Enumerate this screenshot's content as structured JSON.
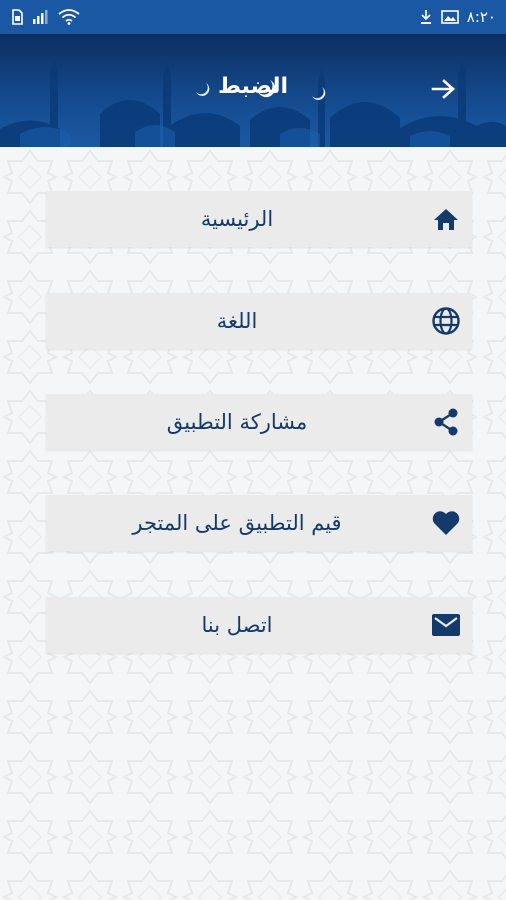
{
  "status_bar": {
    "time": "٨:٢٠"
  },
  "header": {
    "title": "الضبط"
  },
  "menu": {
    "items": [
      {
        "label": "الرئيسية",
        "icon": "home-icon"
      },
      {
        "label": "اللغة",
        "icon": "globe-icon"
      },
      {
        "label": "مشاركة التطبيق",
        "icon": "share-icon"
      },
      {
        "label": "قيم التطبيق على المتجر",
        "icon": "heart-icon"
      },
      {
        "label": "اتصل بنا",
        "icon": "mail-icon"
      }
    ]
  },
  "colors": {
    "status_bar": "#1b58a3",
    "header_dark": "#0c2f62",
    "accent": "#143a6c",
    "menu_bg": "#ebebeb"
  }
}
